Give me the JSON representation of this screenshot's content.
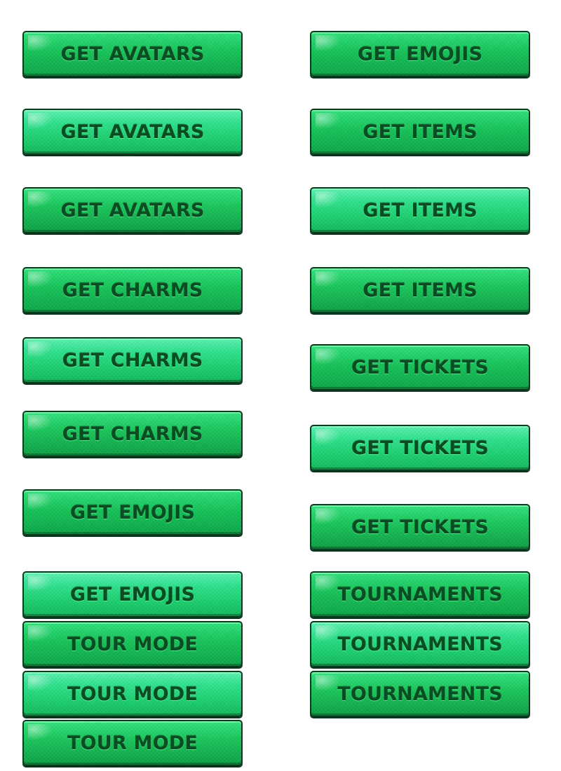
{
  "left_buttons": [
    {
      "label": "GET AVATARS"
    },
    {
      "label": "GET AVATARS"
    },
    {
      "label": "GET AVATARS"
    },
    {
      "label": "GET CHARMS"
    },
    {
      "label": "GET CHARMS"
    },
    {
      "label": "GET CHARMS"
    },
    {
      "label": "GET EMOJIS"
    },
    {
      "label": "GET EMOJIS"
    },
    {
      "label": "TOUR MODE"
    },
    {
      "label": "TOUR MODE"
    },
    {
      "label": "TOUR MODE"
    }
  ],
  "right_buttons": [
    {
      "label": "GET EMOJIS"
    },
    {
      "label": "GET ITEMS"
    },
    {
      "label": "GET ITEMS"
    },
    {
      "label": "GET ITEMS"
    },
    {
      "label": "GET TICKETS"
    },
    {
      "label": "GET TICKETS"
    },
    {
      "label": "GET TICKETS"
    },
    {
      "label": "TOURNAMENTS"
    },
    {
      "label": "TOURNAMENTS"
    },
    {
      "label": "TOURNAMENTS"
    }
  ],
  "colors": {
    "button_green": "#17c259",
    "button_green_light": "#2fe08d",
    "label_dark_green": "#0a4d22",
    "border": "#0b3b1e"
  }
}
